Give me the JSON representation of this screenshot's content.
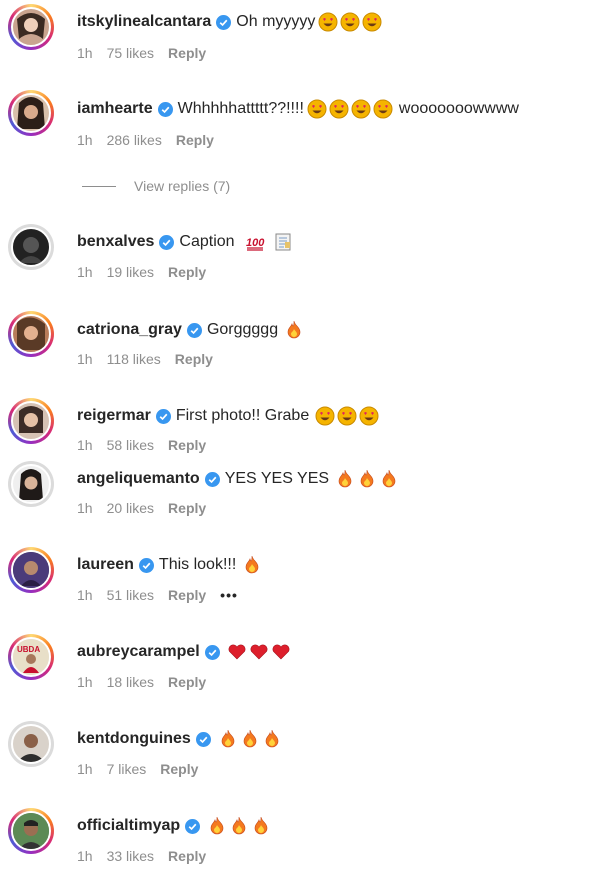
{
  "comments": [
    {
      "user": "itskylinealcantara",
      "text": "Oh myyyyy",
      "emojis": [
        "heart-eyes",
        "heart-eyes",
        "heart-eyes"
      ],
      "time": "1h",
      "likes": "75 likes",
      "reply": "Reply"
    },
    {
      "user": "iamhearte",
      "text": "Whhhhhattttt??!!!!",
      "emojis": [
        "heart-eyes",
        "heart-eyes",
        "heart-eyes",
        "heart-eyes"
      ],
      "text2": "wooooooowwww",
      "time": "1h",
      "likes": "286 likes",
      "reply": "Reply"
    },
    {
      "user": "benxalves",
      "text": "Caption",
      "emojis": [
        "hundred",
        "memo"
      ],
      "time": "1h",
      "likes": "19 likes",
      "reply": "Reply"
    },
    {
      "user": "catriona_gray",
      "text": "Gorggggg",
      "emojis": [
        "fire"
      ],
      "time": "1h",
      "likes": "118 likes",
      "reply": "Reply"
    },
    {
      "user": "reigermar",
      "text": "First photo!! Grabe",
      "emojis": [
        "heart-eyes",
        "heart-eyes",
        "heart-eyes"
      ],
      "time": "1h",
      "likes": "58 likes",
      "reply": "Reply"
    },
    {
      "user": "angeliquemanto",
      "text": "YES YES YES",
      "emojis": [
        "fire",
        "fire",
        "fire"
      ],
      "time": "1h",
      "likes": "20 likes",
      "reply": "Reply"
    },
    {
      "user": "laureen",
      "text": "This look!!!",
      "emojis": [
        "fire"
      ],
      "time": "1h",
      "likes": "51 likes",
      "reply": "Reply",
      "more": "•••"
    },
    {
      "user": "aubreycarampel",
      "text": "",
      "emojis": [
        "red-heart",
        "red-heart",
        "red-heart"
      ],
      "time": "1h",
      "likes": "18 likes",
      "reply": "Reply"
    },
    {
      "user": "kentdonguines",
      "text": "",
      "emojis": [
        "fire",
        "fire",
        "fire"
      ],
      "time": "1h",
      "likes": "7 likes",
      "reply": "Reply"
    },
    {
      "user": "officialtimyap",
      "text": "",
      "emojis": [
        "fire",
        "fire",
        "fire"
      ],
      "time": "1h",
      "likes": "33 likes",
      "reply": "Reply"
    }
  ],
  "view_replies": "View replies (7)",
  "colors": {
    "verified": "#3897f0",
    "meta": "#8e8e8e",
    "text": "#262626"
  }
}
